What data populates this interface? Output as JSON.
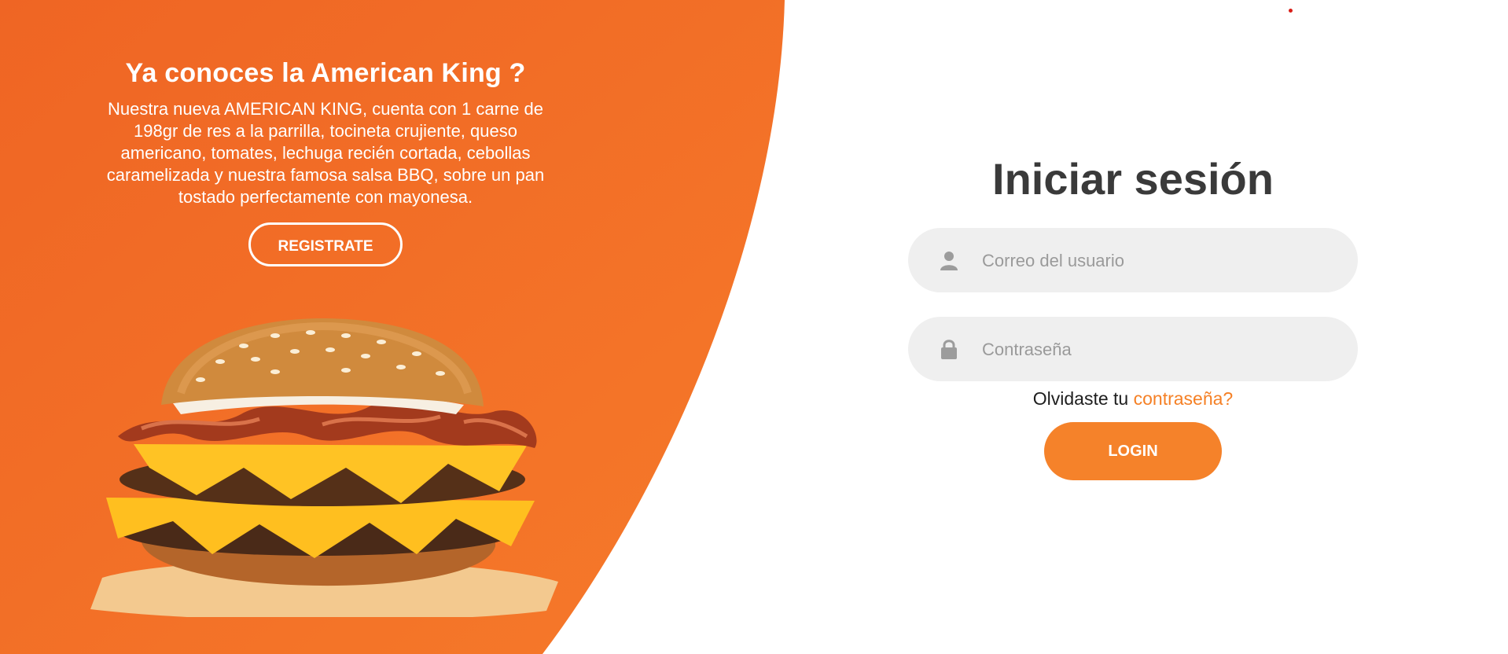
{
  "promo": {
    "title": "Ya conoces la American King ?",
    "description": "Nuestra nueva AMERICAN KING, cuenta con 1 carne de 198gr de res a la parrilla, tocineta crujiente, queso americano, tomates, lechuga recién cortada, cebollas caramelizada y nuestra famosa salsa BBQ, sobre un pan tostado perfectamente con mayonesa.",
    "register_label": "REGISTRATE"
  },
  "login": {
    "title": "Iniciar sesión",
    "email_placeholder": "Correo del usuario",
    "password_placeholder": "Contraseña",
    "forgot_prefix": "Olvidaste tu",
    "forgot_link": "contraseña?",
    "login_label": "LOGIN"
  },
  "colors": {
    "brand_orange": "#f26b21",
    "button_orange": "#f5822a",
    "input_bg": "#efefef",
    "title_gray": "#3a3a3a"
  },
  "icons": {
    "email": "user-icon",
    "password": "lock-icon"
  }
}
